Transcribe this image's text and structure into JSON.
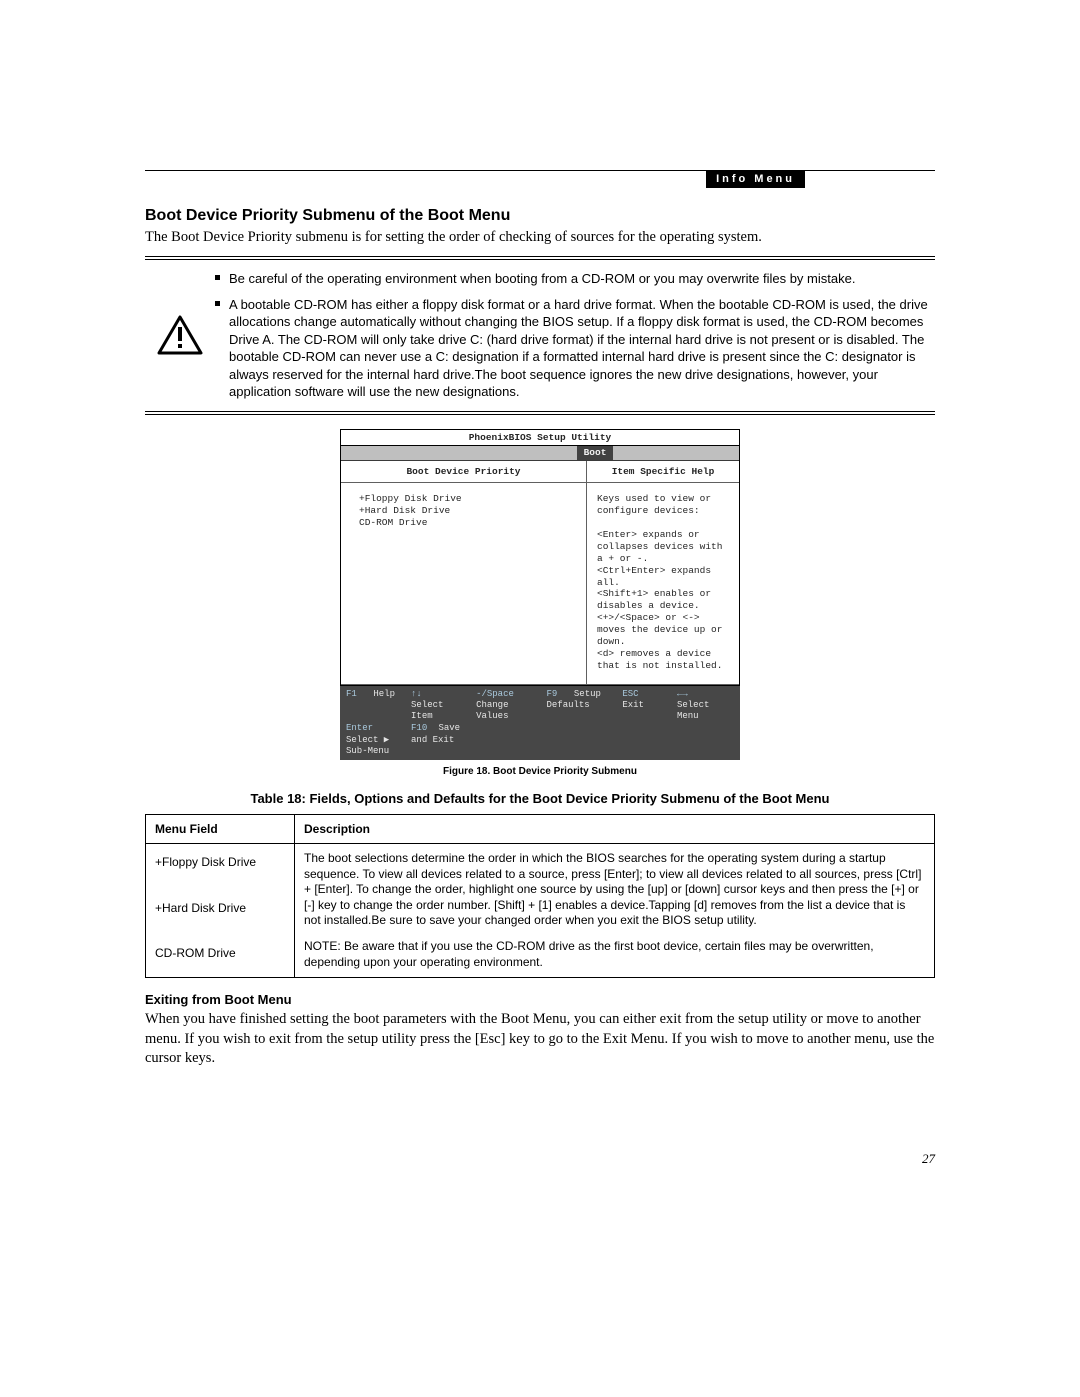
{
  "header_tab": "Info Menu",
  "heading": "Boot Device Priority Submenu of the Boot Menu",
  "intro": "The Boot Device Priority submenu is for setting the order of checking of sources for the operating system.",
  "warnings": [
    "Be careful of the operating environment when booting from a CD-ROM or you may overwrite files by mistake.",
    "A bootable CD-ROM has either a floppy disk format or a hard drive format. When the bootable CD-ROM is used, the drive allocations change automatically without changing the BIOS setup. If a floppy disk format is used, the CD-ROM becomes Drive A. The CD-ROM will only take drive C: (hard drive format) if the internal hard drive is not present or is disabled. The bootable CD-ROM can never use a C: designation if a formatted internal hard drive is present since the C: designator is always reserved for the internal hard drive.The boot sequence ignores the new drive designations, however, your application software will use the new designations."
  ],
  "bios": {
    "title": "PhoenixBIOS Setup Utility",
    "tab": "Boot",
    "left_heading": "Boot Device Priority",
    "right_heading": "Item Specific Help",
    "devices": "+Floppy Disk Drive\n+Hard Disk Drive\n CD-ROM Drive",
    "help_text": "Keys used to view or\nconfigure devices:\n\n<Enter> expands or\ncollapses devices with\na + or -.\n<Ctrl+Enter> expands\nall.\n<Shift+1> enables or\ndisables a device.\n<+>/<Space> or <->\nmoves the device up or\ndown.\n<d> removes a device\nthat is not installed.",
    "footer": {
      "f1": "F1",
      "f1_l": "Help",
      "ud": "↑↓",
      "ud_l": "Select Item",
      "sp": "-/Space",
      "sp_l": "Change Values",
      "f9": "F9",
      "f9_l": "Setup Defaults",
      "esc": "ESC",
      "esc_l": "Exit",
      "lr": "←→",
      "lr_l": "Select Menu",
      "en": "Enter",
      "en_l": "Select ▶ Sub-Menu",
      "f10": "F10",
      "f10_l": "Save and Exit"
    }
  },
  "figure_caption": "Figure 18.  Boot Device Priority Submenu",
  "table_title": "Table 18: Fields, Options and Defaults for the Boot Device Priority Submenu of the Boot Menu",
  "table": {
    "head_field": "Menu Field",
    "head_desc": "Description",
    "menu_field": "+Floppy Disk Drive\n\n+Hard Disk Drive\n\nCD-ROM Drive",
    "desc_main": "The boot selections determine the order in which the BIOS searches for the operating system during a startup sequence. To view all devices related to a source, press [Enter]; to view all devices related to all sources, press [Ctrl] + [Enter]. To change the order, highlight one source by using the [up] or [down] cursor keys and then press the [+] or [-] key to change the order number. [Shift] + [1] enables a device.Tapping [d] removes from the list a device that is not installed.Be sure to save your changed order when you exit the BIOS setup utility.",
    "desc_note": "NOTE: Be aware that if you use the CD-ROM drive as the first boot device, certain files may be overwritten, depending upon your operating environment."
  },
  "exit_heading": "Exiting from Boot Menu",
  "exit_para": "When you have finished setting the boot parameters with the Boot Menu, you can either exit from the setup utility or move to another menu. If you wish to exit from the setup utility press the [Esc] key to go to the Exit Menu. If you wish to move to another menu, use the cursor keys.",
  "page_number": "27"
}
